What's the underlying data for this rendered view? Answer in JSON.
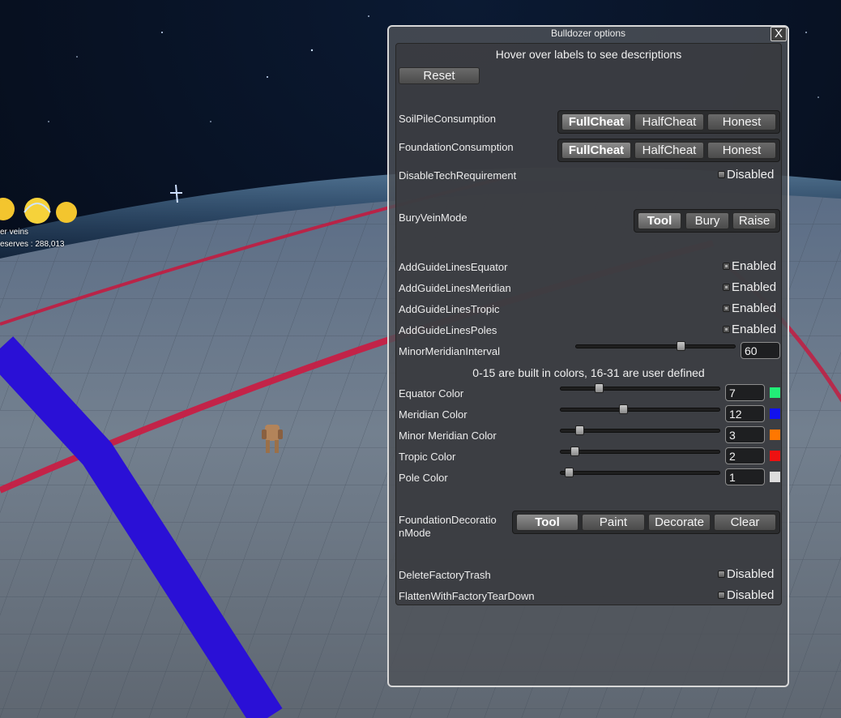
{
  "hud": {
    "veins_label": "er veins",
    "reserves_label": "eserves : 288,013"
  },
  "window": {
    "title": "Bulldozer options",
    "close_label": "X",
    "hint": "Hover over labels to see descriptions",
    "reset_label": "Reset",
    "soil_pile": {
      "label": "SoilPileConsumption",
      "options": [
        "FullCheat",
        "HalfCheat",
        "Honest"
      ],
      "selected": "FullCheat"
    },
    "foundation": {
      "label": "FoundationConsumption",
      "options": [
        "FullCheat",
        "HalfCheat",
        "Honest"
      ],
      "selected": "FullCheat"
    },
    "disable_tech": {
      "label": "DisableTechRequirement",
      "state": "Disabled"
    },
    "bury_vein": {
      "label": "BuryVeinMode",
      "options": [
        "Tool",
        "Bury",
        "Raise"
      ],
      "selected": "Tool"
    },
    "guide_equator": {
      "label": "AddGuideLinesEquator",
      "state": "Enabled"
    },
    "guide_meridian": {
      "label": "AddGuideLinesMeridian",
      "state": "Enabled"
    },
    "guide_tropic": {
      "label": "AddGuideLinesTropic",
      "state": "Enabled"
    },
    "guide_poles": {
      "label": "AddGuideLinesPoles",
      "state": "Enabled"
    },
    "minor_interval": {
      "label": "MinorMeridianInterval",
      "value": "60",
      "slider_fraction": 0.67
    },
    "colors_hint": "0-15 are built in colors, 16-31 are user defined",
    "equator_color": {
      "label": "Equator Color",
      "value": "7",
      "slider_fraction": 0.23,
      "swatch": "#22ee77"
    },
    "meridian_color": {
      "label": "Meridian Color",
      "value": "12",
      "slider_fraction": 0.39,
      "swatch": "#1111ee"
    },
    "minor_meridian_color": {
      "label": "Minor Meridian Color",
      "value": "3",
      "slider_fraction": 0.1,
      "swatch": "#ff7700"
    },
    "tropic_color": {
      "label": "Tropic Color",
      "value": "2",
      "slider_fraction": 0.07,
      "swatch": "#ee1111"
    },
    "pole_color": {
      "label": "Pole Color",
      "value": "1",
      "slider_fraction": 0.03,
      "swatch": "#dddddd"
    },
    "decoration": {
      "label_line1": "FoundationDecoratio",
      "label_line2": "nMode",
      "options": [
        "Tool",
        "Paint",
        "Decorate",
        "Clear"
      ],
      "selected": "Tool"
    },
    "delete_trash": {
      "label": "DeleteFactoryTrash",
      "state": "Disabled"
    },
    "flatten": {
      "label": "FlattenWithFactoryTearDown",
      "state": "Disabled"
    }
  }
}
